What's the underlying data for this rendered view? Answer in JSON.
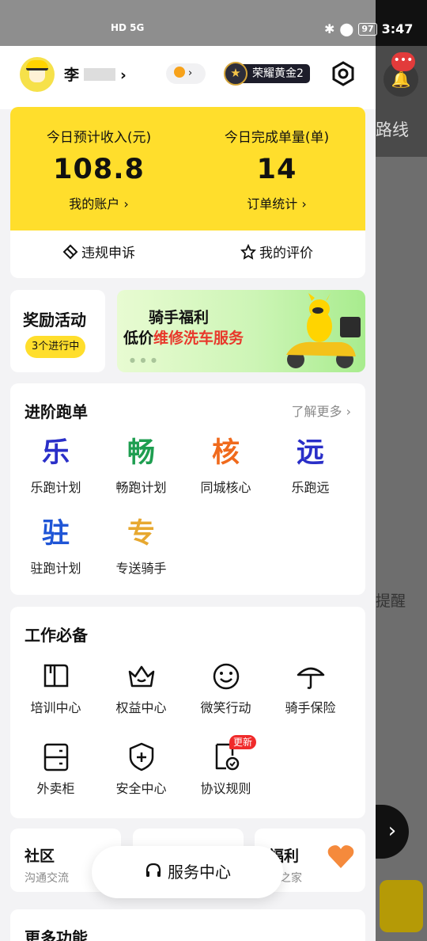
{
  "status_bar": {
    "network": "HD 5G",
    "battery": "97",
    "time": "3:47"
  },
  "background_page": {
    "route_text": "路线",
    "remind_text": "提醒",
    "notification_dots": "•••"
  },
  "profile": {
    "name": "李",
    "rank": "荣耀黄金2"
  },
  "income": {
    "left_title": "今日预计收入(元)",
    "left_value": "108.8",
    "left_link": "我的账户",
    "right_title": "今日完成单量(单)",
    "right_value": "14",
    "right_link": "订单统计",
    "violation_label": "违规申诉",
    "review_label": "我的评价"
  },
  "reward": {
    "title": "奖励活动",
    "badge": "3个进行中"
  },
  "banner": {
    "line1": "骑手福利",
    "line2_prefix": "低价",
    "line2_highlight": "维修洗车服务"
  },
  "advance": {
    "title": "进阶跑单",
    "more": "了解更多",
    "items": [
      {
        "glyph": "乐",
        "label": "乐跑计划",
        "color": "#2a2fc8"
      },
      {
        "glyph": "畅",
        "label": "畅跑计划",
        "color": "#1e9e50"
      },
      {
        "glyph": "核",
        "label": "同城核心",
        "color": "#f06a1c"
      },
      {
        "glyph": "远",
        "label": "乐跑远",
        "color": "#2a2fc8"
      },
      {
        "glyph": "驻",
        "label": "驻跑计划",
        "color": "#1f55d6"
      },
      {
        "glyph": "专",
        "label": "专送骑手",
        "color": "#e7a830"
      }
    ]
  },
  "work": {
    "title": "工作必备",
    "items": [
      {
        "label": "培训中心",
        "icon": "book-icon"
      },
      {
        "label": "权益中心",
        "icon": "crown-icon"
      },
      {
        "label": "微笑行动",
        "icon": "smile-icon"
      },
      {
        "label": "骑手保险",
        "icon": "umbrella-icon"
      },
      {
        "label": "外卖柜",
        "icon": "locker-icon"
      },
      {
        "label": "安全中心",
        "icon": "shield-icon"
      },
      {
        "label": "协议规则",
        "icon": "document-check-icon"
      }
    ],
    "new_badge": "更新"
  },
  "bottom": {
    "community_title": "社区",
    "community_sub": "沟通交流",
    "welfare_title": "福利",
    "welfare_sub": "手之家",
    "service_center": "服务中心",
    "more_functions": "更多功能"
  }
}
